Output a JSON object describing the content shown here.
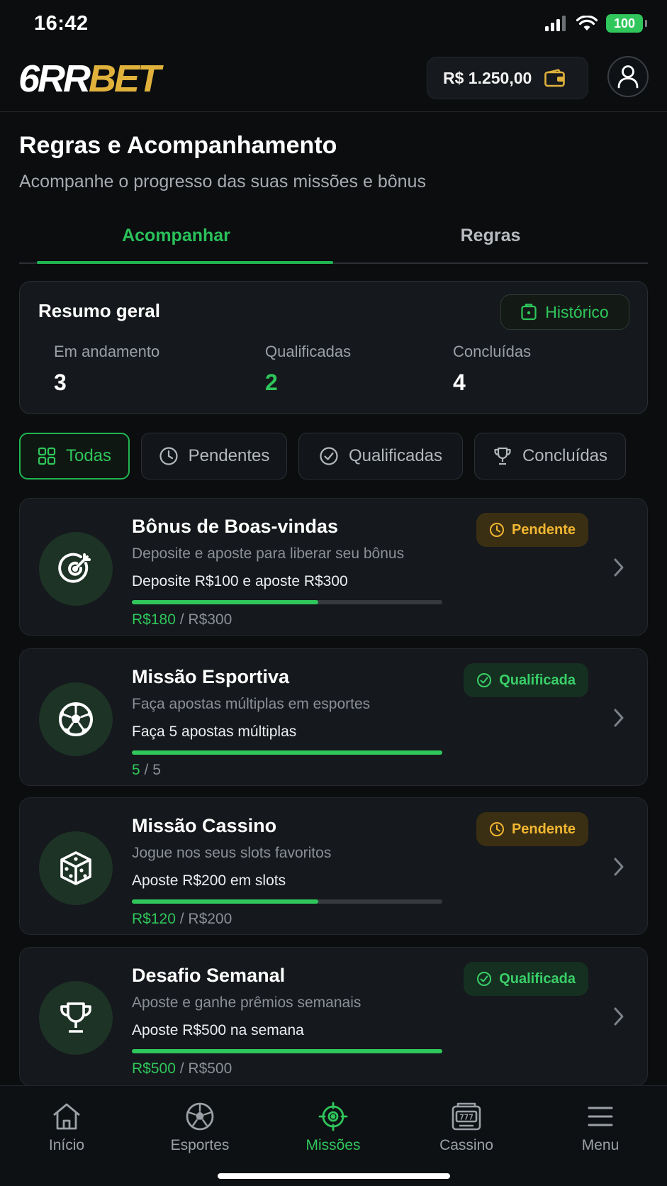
{
  "status_bar": {
    "time": "16:42",
    "battery": "100"
  },
  "header": {
    "logo_white": "6RR",
    "logo_gold": "BET",
    "balance": "R$ 1.250,00"
  },
  "page": {
    "title": "Regras e Acompanhamento",
    "subtitle": "Acompanhe o progresso das suas missões e bônus"
  },
  "tabs": [
    {
      "label": "Acompanhar",
      "active": true
    },
    {
      "label": "Regras",
      "active": false
    }
  ],
  "summary": {
    "title": "Resumo geral",
    "history_label": "Histórico",
    "stats": [
      {
        "label": "Em andamento",
        "value": "3"
      },
      {
        "label": "Qualificadas",
        "value": "2"
      },
      {
        "label": "Concluídas",
        "value": "4"
      }
    ]
  },
  "filters": [
    {
      "label": "Todas",
      "icon": "grid-icon",
      "active": true
    },
    {
      "label": "Pendentes",
      "icon": "clock-icon",
      "active": false
    },
    {
      "label": "Qualificadas",
      "icon": "check-circle-icon",
      "active": false
    },
    {
      "label": "Concluídas",
      "icon": "trophy-icon",
      "active": false
    }
  ],
  "missions": [
    {
      "title": "Bônus de Boas-vindas",
      "description": "Deposite e aposte para liberar seu bônus",
      "goal": "Deposite R$100 e aposte R$300",
      "progress_current": "R$180",
      "progress_total": "/ R$300",
      "progress_fraction": 0.6,
      "status": "Pendente",
      "icon": "target-icon"
    },
    {
      "title": "Missão Esportiva",
      "description": "Faça apostas múltiplas em esportes",
      "goal": "Faça 5 apostas múltiplas",
      "progress_current": "5",
      "progress_total": "/ 5",
      "progress_fraction": 1.0,
      "status": "Qualificada",
      "icon": "soccer-ball-icon"
    },
    {
      "title": "Missão Cassino",
      "description": "Jogue nos seus slots favoritos",
      "goal": "Aposte R$200 em slots",
      "progress_current": "R$120",
      "progress_total": "/ R$200",
      "progress_fraction": 0.6,
      "status": "Pendente",
      "icon": "dice-icon"
    },
    {
      "title": "Desafio Semanal",
      "description": "Aposte e ganhe prêmios semanais",
      "goal": "Aposte R$500 na semana",
      "progress_current": "R$500",
      "progress_total": "/ R$500",
      "progress_fraction": 1.0,
      "status": "Qualificada",
      "icon": "trophy-icon"
    }
  ],
  "bottom_nav": [
    {
      "label": "Início",
      "icon": "home-icon",
      "active": false
    },
    {
      "label": "Esportes",
      "icon": "soccer-ball-icon",
      "active": false
    },
    {
      "label": "Missões",
      "icon": "target-icon",
      "active": true
    },
    {
      "label": "Cassino",
      "icon": "slot-machine-icon",
      "active": false
    },
    {
      "label": "Menu",
      "icon": "hamburger-icon",
      "active": false
    }
  ],
  "colors": {
    "background": "#0b0d0f",
    "accent_green": "#2fc65b",
    "pending_amber": "#f2b632",
    "logo_gold": "#e0b23c"
  }
}
